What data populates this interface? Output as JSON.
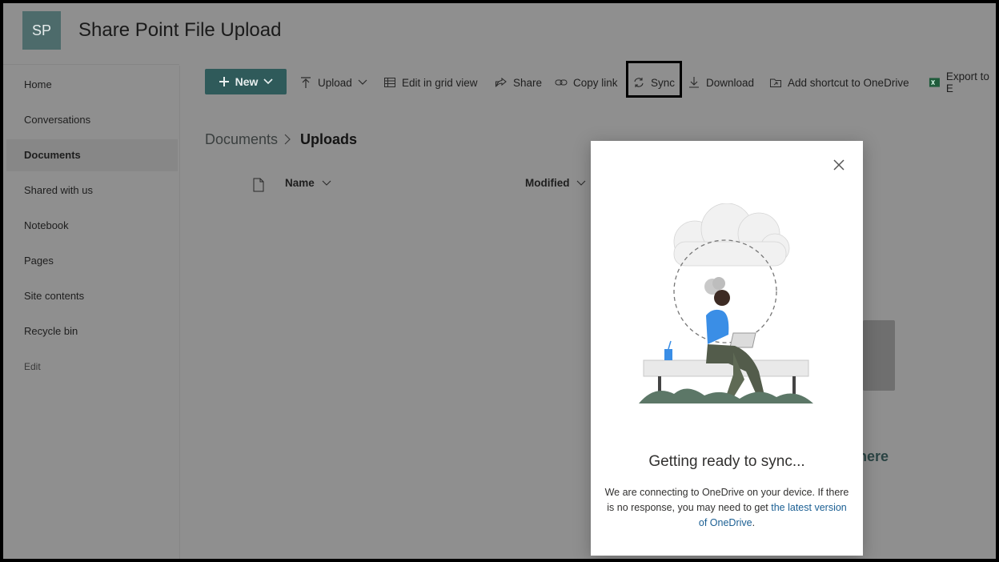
{
  "site": {
    "logo": "SP",
    "title": "Share Point File Upload"
  },
  "nav": {
    "items": [
      {
        "label": "Home"
      },
      {
        "label": "Conversations"
      },
      {
        "label": "Documents",
        "active": true
      },
      {
        "label": "Shared with us"
      },
      {
        "label": "Notebook"
      },
      {
        "label": "Pages"
      },
      {
        "label": "Site contents"
      },
      {
        "label": "Recycle bin"
      }
    ],
    "edit": "Edit"
  },
  "commandbar": {
    "new_label": "New",
    "upload": "Upload",
    "grid": "Edit in grid view",
    "share": "Share",
    "copy_link": "Copy link",
    "sync": "Sync",
    "download": "Download",
    "shortcut": "Add shortcut to OneDrive",
    "export": "Export to E"
  },
  "breadcrumb": {
    "parent": "Documents",
    "current": "Uploads"
  },
  "columns": {
    "name": "Name",
    "modified": "Modified"
  },
  "background_hint": "here",
  "dialog": {
    "title": "Getting ready to sync...",
    "body_text": "We are connecting to OneDrive on your device. If there is no response, you may need to get ",
    "body_link": "the latest version of OneDrive",
    "body_end": "."
  },
  "colors": {
    "accent": "#2f5a5a",
    "link": "#1b5f93",
    "dim_overlay": "#8f8f8f"
  },
  "icons": [
    "plus-icon",
    "chevron-down-icon",
    "upload-icon",
    "grid-icon",
    "share-icon",
    "link-icon",
    "sync-icon",
    "download-icon",
    "shortcut-icon",
    "excel-icon",
    "document-icon",
    "close-icon"
  ]
}
